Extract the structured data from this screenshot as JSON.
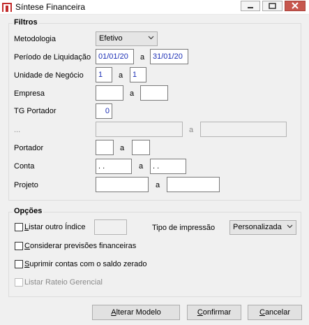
{
  "window": {
    "title": "Síntese Financeira"
  },
  "filters": {
    "title": "Filtros",
    "metodologia": {
      "label": "Metodologia",
      "value": "Efetivo"
    },
    "periodo": {
      "label": "Período de Liquidação",
      "from": "01/01/20",
      "sep": "a",
      "to": "31/01/20"
    },
    "unidade": {
      "label": "Unidade de Negócio",
      "from": "1",
      "sep": "a",
      "to": "1"
    },
    "empresa": {
      "label": "Empresa",
      "from": "",
      "sep": "a",
      "to": ""
    },
    "tg_portador": {
      "label": "TG Portador",
      "value": "0"
    },
    "ellipsis": {
      "label": "...",
      "from": "",
      "sep": "a",
      "to": ""
    },
    "portador": {
      "label": "Portador",
      "from": "",
      "sep": "a",
      "to": ""
    },
    "conta": {
      "label": "Conta",
      "from": ". .",
      "sep": "a",
      "to": ". ."
    },
    "projeto": {
      "label": "Projeto",
      "from": "",
      "sep": "a",
      "to": ""
    }
  },
  "options": {
    "title": "Opções",
    "listar_outro_indice": {
      "label_u": "L",
      "label_rest": "istar outro Índice",
      "checked": false,
      "value": ""
    },
    "tipo_impressao": {
      "label": "Tipo de impressão",
      "value": "Personalizada"
    },
    "considerar": {
      "label_u": "C",
      "label_rest": "onsiderar previsões financeiras",
      "checked": false
    },
    "suprimir": {
      "label_u": "S",
      "label_rest": "uprimir contas com o saldo zerado",
      "checked": false
    },
    "rateio": {
      "label": "Listar Rateio Gerencial",
      "checked": false,
      "enabled": false
    }
  },
  "buttons": {
    "alterar": {
      "u": "A",
      "rest": "lterar Modelo"
    },
    "confirmar": {
      "u": "C",
      "rest": "onfirmar"
    },
    "cancelar": {
      "u": "C",
      "rest": "ancelar"
    }
  }
}
